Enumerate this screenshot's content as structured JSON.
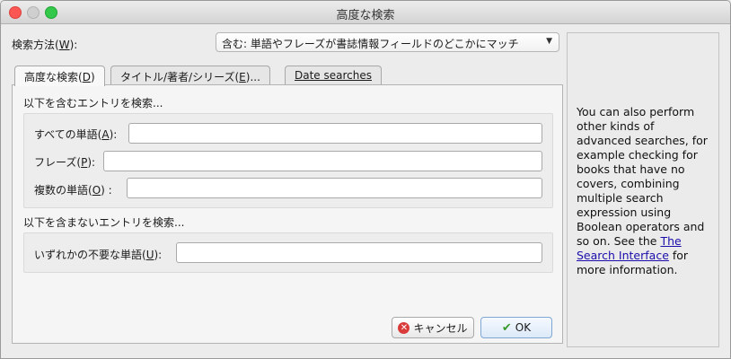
{
  "window": {
    "title": "高度な検索"
  },
  "method": {
    "label": "検索方法(",
    "mnemonic": "W",
    "label_end": "):",
    "selected": "含む: 単語やフレーズが書誌情報フィールドのどこかにマッチ"
  },
  "tabs": [
    {
      "label": "高度な検索(",
      "mnemonic": "D",
      "label_end": ")"
    },
    {
      "label": "タイトル/著者/シリーズ(",
      "mnemonic": "E",
      "label_end": ")..."
    },
    {
      "label": "Date searches"
    }
  ],
  "include_section": {
    "heading": "以下を含むエントリを検索...",
    "all_words": {
      "label": "すべての単語(",
      "mnemonic": "A",
      "label_end": "):",
      "value": ""
    },
    "phrase": {
      "label": "フレーズ(",
      "mnemonic": "P",
      "label_end": "):",
      "value": ""
    },
    "multiple_words": {
      "label": "複数の単語(",
      "mnemonic": "O",
      "label_end": ") :",
      "value": ""
    }
  },
  "exclude_section": {
    "heading": "以下を含まないエントリを検索...",
    "any_unwanted": {
      "label": "いずれかの不要な単語(",
      "mnemonic": "U",
      "label_end": "):",
      "value": ""
    }
  },
  "buttons": {
    "cancel": "キャンセル",
    "ok": "OK"
  },
  "help": {
    "text": "You can also perform other kinds of advanced searches, for example checking for books that have no covers, combining multiple search expression using Boolean operators and so on. See the ",
    "link": "The Search Interface",
    "tail": " for more information."
  }
}
